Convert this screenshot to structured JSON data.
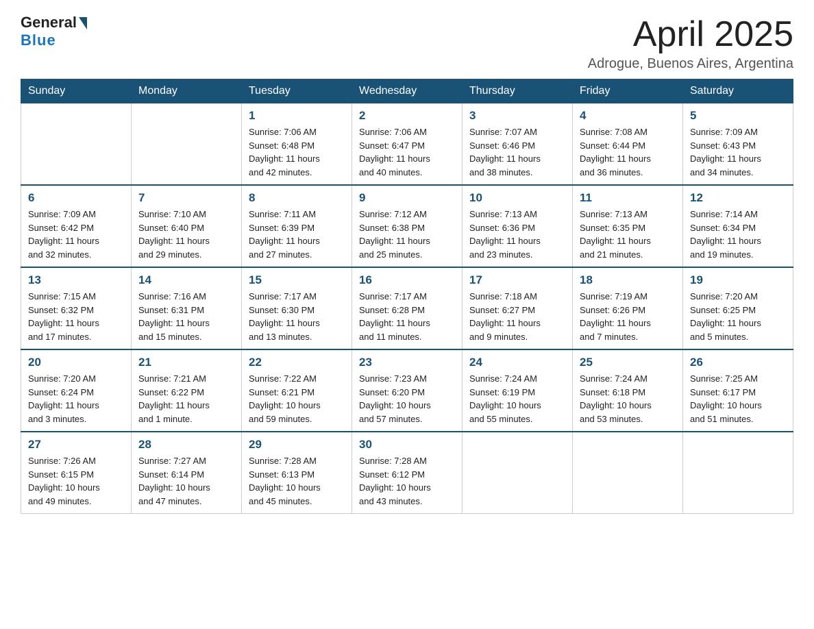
{
  "header": {
    "logo_general": "General",
    "logo_blue": "Blue",
    "month_title": "April 2025",
    "location": "Adrogue, Buenos Aires, Argentina"
  },
  "weekdays": [
    "Sunday",
    "Monday",
    "Tuesday",
    "Wednesday",
    "Thursday",
    "Friday",
    "Saturday"
  ],
  "weeks": [
    [
      {
        "day": "",
        "info": ""
      },
      {
        "day": "",
        "info": ""
      },
      {
        "day": "1",
        "info": "Sunrise: 7:06 AM\nSunset: 6:48 PM\nDaylight: 11 hours\nand 42 minutes."
      },
      {
        "day": "2",
        "info": "Sunrise: 7:06 AM\nSunset: 6:47 PM\nDaylight: 11 hours\nand 40 minutes."
      },
      {
        "day": "3",
        "info": "Sunrise: 7:07 AM\nSunset: 6:46 PM\nDaylight: 11 hours\nand 38 minutes."
      },
      {
        "day": "4",
        "info": "Sunrise: 7:08 AM\nSunset: 6:44 PM\nDaylight: 11 hours\nand 36 minutes."
      },
      {
        "day": "5",
        "info": "Sunrise: 7:09 AM\nSunset: 6:43 PM\nDaylight: 11 hours\nand 34 minutes."
      }
    ],
    [
      {
        "day": "6",
        "info": "Sunrise: 7:09 AM\nSunset: 6:42 PM\nDaylight: 11 hours\nand 32 minutes."
      },
      {
        "day": "7",
        "info": "Sunrise: 7:10 AM\nSunset: 6:40 PM\nDaylight: 11 hours\nand 29 minutes."
      },
      {
        "day": "8",
        "info": "Sunrise: 7:11 AM\nSunset: 6:39 PM\nDaylight: 11 hours\nand 27 minutes."
      },
      {
        "day": "9",
        "info": "Sunrise: 7:12 AM\nSunset: 6:38 PM\nDaylight: 11 hours\nand 25 minutes."
      },
      {
        "day": "10",
        "info": "Sunrise: 7:13 AM\nSunset: 6:36 PM\nDaylight: 11 hours\nand 23 minutes."
      },
      {
        "day": "11",
        "info": "Sunrise: 7:13 AM\nSunset: 6:35 PM\nDaylight: 11 hours\nand 21 minutes."
      },
      {
        "day": "12",
        "info": "Sunrise: 7:14 AM\nSunset: 6:34 PM\nDaylight: 11 hours\nand 19 minutes."
      }
    ],
    [
      {
        "day": "13",
        "info": "Sunrise: 7:15 AM\nSunset: 6:32 PM\nDaylight: 11 hours\nand 17 minutes."
      },
      {
        "day": "14",
        "info": "Sunrise: 7:16 AM\nSunset: 6:31 PM\nDaylight: 11 hours\nand 15 minutes."
      },
      {
        "day": "15",
        "info": "Sunrise: 7:17 AM\nSunset: 6:30 PM\nDaylight: 11 hours\nand 13 minutes."
      },
      {
        "day": "16",
        "info": "Sunrise: 7:17 AM\nSunset: 6:28 PM\nDaylight: 11 hours\nand 11 minutes."
      },
      {
        "day": "17",
        "info": "Sunrise: 7:18 AM\nSunset: 6:27 PM\nDaylight: 11 hours\nand 9 minutes."
      },
      {
        "day": "18",
        "info": "Sunrise: 7:19 AM\nSunset: 6:26 PM\nDaylight: 11 hours\nand 7 minutes."
      },
      {
        "day": "19",
        "info": "Sunrise: 7:20 AM\nSunset: 6:25 PM\nDaylight: 11 hours\nand 5 minutes."
      }
    ],
    [
      {
        "day": "20",
        "info": "Sunrise: 7:20 AM\nSunset: 6:24 PM\nDaylight: 11 hours\nand 3 minutes."
      },
      {
        "day": "21",
        "info": "Sunrise: 7:21 AM\nSunset: 6:22 PM\nDaylight: 11 hours\nand 1 minute."
      },
      {
        "day": "22",
        "info": "Sunrise: 7:22 AM\nSunset: 6:21 PM\nDaylight: 10 hours\nand 59 minutes."
      },
      {
        "day": "23",
        "info": "Sunrise: 7:23 AM\nSunset: 6:20 PM\nDaylight: 10 hours\nand 57 minutes."
      },
      {
        "day": "24",
        "info": "Sunrise: 7:24 AM\nSunset: 6:19 PM\nDaylight: 10 hours\nand 55 minutes."
      },
      {
        "day": "25",
        "info": "Sunrise: 7:24 AM\nSunset: 6:18 PM\nDaylight: 10 hours\nand 53 minutes."
      },
      {
        "day": "26",
        "info": "Sunrise: 7:25 AM\nSunset: 6:17 PM\nDaylight: 10 hours\nand 51 minutes."
      }
    ],
    [
      {
        "day": "27",
        "info": "Sunrise: 7:26 AM\nSunset: 6:15 PM\nDaylight: 10 hours\nand 49 minutes."
      },
      {
        "day": "28",
        "info": "Sunrise: 7:27 AM\nSunset: 6:14 PM\nDaylight: 10 hours\nand 47 minutes."
      },
      {
        "day": "29",
        "info": "Sunrise: 7:28 AM\nSunset: 6:13 PM\nDaylight: 10 hours\nand 45 minutes."
      },
      {
        "day": "30",
        "info": "Sunrise: 7:28 AM\nSunset: 6:12 PM\nDaylight: 10 hours\nand 43 minutes."
      },
      {
        "day": "",
        "info": ""
      },
      {
        "day": "",
        "info": ""
      },
      {
        "day": "",
        "info": ""
      }
    ]
  ]
}
